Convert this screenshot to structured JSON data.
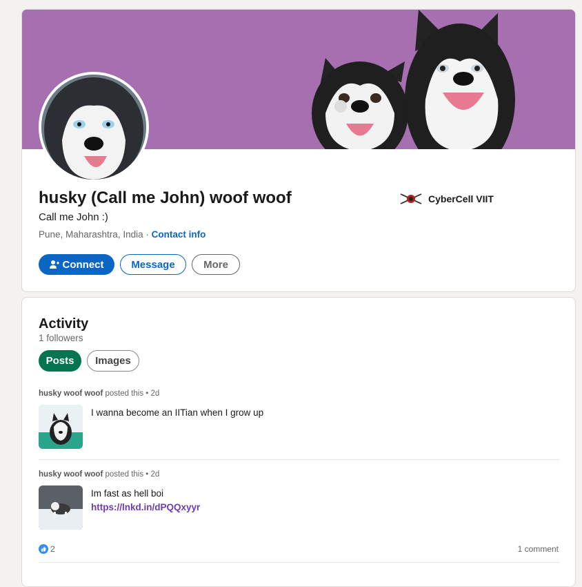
{
  "profile": {
    "name": "husky (Call me John) woof woof",
    "headline": "Call me John :)",
    "location": "Pune, Maharashtra, India",
    "separator": " · ",
    "contact_info": "Contact info",
    "company": "CyberCell VIIT"
  },
  "actions": {
    "connect": "Connect",
    "message": "Message",
    "more": "More"
  },
  "activity": {
    "title": "Activity",
    "followers": "1 followers",
    "tabs": [
      "Posts",
      "Images"
    ],
    "posts": [
      {
        "author": "husky woof woof",
        "meta": " posted this • 2d",
        "text": "I wanna become an IITian when I grow up"
      },
      {
        "author": "husky woof woof",
        "meta": " posted this • 2d",
        "text": "Im fast as hell boi",
        "link": "https://lnkd.in/dPQQxyyr",
        "reactions": "2",
        "comments": "1 comment"
      }
    ]
  },
  "colors": {
    "banner": "#a56fb0",
    "primary": "#0a66c2",
    "posts_tab": "#01754f",
    "link_visited": "#6c3db5"
  }
}
